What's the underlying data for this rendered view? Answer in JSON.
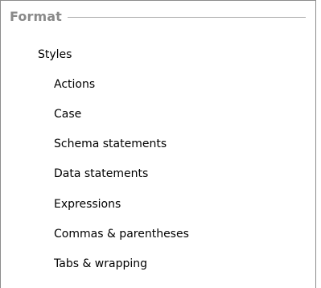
{
  "section": {
    "title": "Format"
  },
  "tree": {
    "root_label": "Styles",
    "children": [
      "Actions",
      "Case",
      "Schema statements",
      "Data statements",
      "Expressions",
      "Commas & parentheses",
      "Tabs & wrapping"
    ]
  }
}
